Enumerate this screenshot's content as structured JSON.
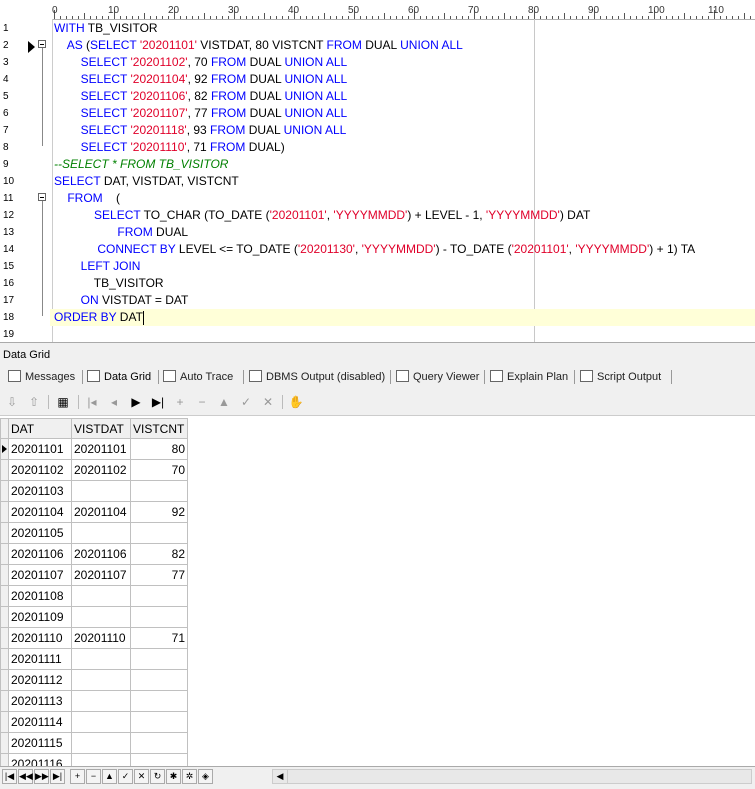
{
  "editor": {
    "ruler_labels": [
      "0",
      "10",
      "20",
      "30",
      "40",
      "50",
      "60",
      "70",
      "80",
      "90",
      "100",
      "110"
    ],
    "line_numbers": [
      "1",
      "2",
      "3",
      "4",
      "5",
      "6",
      "7",
      "8",
      "9",
      "10",
      "11",
      "12",
      "13",
      "14",
      "15",
      "16",
      "17",
      "18",
      "19"
    ],
    "lines": [
      [
        [
          "k",
          "WITH "
        ],
        [
          "n",
          "TB_VISITOR"
        ]
      ],
      [
        [
          "n",
          "    "
        ],
        [
          "k",
          "AS "
        ],
        [
          "n",
          "("
        ],
        [
          "k",
          "SELECT "
        ],
        [
          "s",
          "'20201101'"
        ],
        [
          "n",
          " VISTDAT, 80 VISTCNT "
        ],
        [
          "k",
          "FROM "
        ],
        [
          "n",
          "DUAL "
        ],
        [
          "k",
          "UNION ALL"
        ]
      ],
      [
        [
          "n",
          "        "
        ],
        [
          "k",
          "SELECT "
        ],
        [
          "s",
          "'20201102'"
        ],
        [
          "n",
          ", 70 "
        ],
        [
          "k",
          "FROM "
        ],
        [
          "n",
          "DUAL "
        ],
        [
          "k",
          "UNION ALL"
        ]
      ],
      [
        [
          "n",
          "        "
        ],
        [
          "k",
          "SELECT "
        ],
        [
          "s",
          "'20201104'"
        ],
        [
          "n",
          ", 92 "
        ],
        [
          "k",
          "FROM "
        ],
        [
          "n",
          "DUAL "
        ],
        [
          "k",
          "UNION ALL"
        ]
      ],
      [
        [
          "n",
          "        "
        ],
        [
          "k",
          "SELECT "
        ],
        [
          "s",
          "'20201106'"
        ],
        [
          "n",
          ", 82 "
        ],
        [
          "k",
          "FROM "
        ],
        [
          "n",
          "DUAL "
        ],
        [
          "k",
          "UNION ALL"
        ]
      ],
      [
        [
          "n",
          "        "
        ],
        [
          "k",
          "SELECT "
        ],
        [
          "s",
          "'20201107'"
        ],
        [
          "n",
          ", 77 "
        ],
        [
          "k",
          "FROM "
        ],
        [
          "n",
          "DUAL "
        ],
        [
          "k",
          "UNION ALL"
        ]
      ],
      [
        [
          "n",
          "        "
        ],
        [
          "k",
          "SELECT "
        ],
        [
          "s",
          "'20201118'"
        ],
        [
          "n",
          ", 93 "
        ],
        [
          "k",
          "FROM "
        ],
        [
          "n",
          "DUAL "
        ],
        [
          "k",
          "UNION ALL"
        ]
      ],
      [
        [
          "n",
          "        "
        ],
        [
          "k",
          "SELECT "
        ],
        [
          "s",
          "'20201110'"
        ],
        [
          "n",
          ", 71 "
        ],
        [
          "k",
          "FROM "
        ],
        [
          "n",
          "DUAL)"
        ]
      ],
      [
        [
          "c",
          "--SELECT * FROM TB_VISITOR"
        ]
      ],
      [
        [
          "k",
          "SELECT "
        ],
        [
          "n",
          "DAT, VISTDAT, VISTCNT"
        ]
      ],
      [
        [
          "n",
          "    "
        ],
        [
          "k",
          "FROM"
        ],
        [
          "n",
          "    ("
        ]
      ],
      [
        [
          "n",
          "            "
        ],
        [
          "k",
          "SELECT "
        ],
        [
          "n",
          "TO_CHAR (TO_DATE ("
        ],
        [
          "s",
          "'20201101'"
        ],
        [
          "n",
          ", "
        ],
        [
          "s",
          "'YYYYMMDD'"
        ],
        [
          "n",
          ") + LEVEL - 1, "
        ],
        [
          "s",
          "'YYYYMMDD'"
        ],
        [
          "n",
          ") DAT"
        ]
      ],
      [
        [
          "n",
          "                   "
        ],
        [
          "k",
          "FROM "
        ],
        [
          "n",
          "DUAL"
        ]
      ],
      [
        [
          "n",
          "             "
        ],
        [
          "k",
          "CONNECT BY "
        ],
        [
          "n",
          "LEVEL <= TO_DATE ("
        ],
        [
          "s",
          "'20201130'"
        ],
        [
          "n",
          ", "
        ],
        [
          "s",
          "'YYYYMMDD'"
        ],
        [
          "n",
          ") - TO_DATE ("
        ],
        [
          "s",
          "'20201101'"
        ],
        [
          "n",
          ", "
        ],
        [
          "s",
          "'YYYYMMDD'"
        ],
        [
          "n",
          ") + 1) TA"
        ]
      ],
      [
        [
          "n",
          "        "
        ],
        [
          "k",
          "LEFT JOIN"
        ]
      ],
      [
        [
          "n",
          "            TB_VISITOR"
        ]
      ],
      [
        [
          "n",
          "        "
        ],
        [
          "k",
          "ON "
        ],
        [
          "n",
          "VISTDAT = DAT"
        ]
      ],
      [
        [
          "k",
          "ORDER BY "
        ],
        [
          "n",
          "DAT"
        ]
      ],
      []
    ]
  },
  "panel": {
    "title": "Data Grid",
    "tabs": [
      "Messages",
      "Data Grid",
      "Auto Trace",
      "DBMS Output (disabled)",
      "Query Viewer",
      "Explain Plan",
      "Script Output"
    ]
  },
  "grid": {
    "columns": [
      "DAT",
      "VISTDAT",
      "VISTCNT"
    ],
    "rows": [
      [
        "20201101",
        "20201101",
        "80"
      ],
      [
        "20201102",
        "20201102",
        "70"
      ],
      [
        "20201103",
        "",
        ""
      ],
      [
        "20201104",
        "20201104",
        "92"
      ],
      [
        "20201105",
        "",
        ""
      ],
      [
        "20201106",
        "20201106",
        "82"
      ],
      [
        "20201107",
        "20201107",
        "77"
      ],
      [
        "20201108",
        "",
        ""
      ],
      [
        "20201109",
        "",
        ""
      ],
      [
        "20201110",
        "20201110",
        "71"
      ],
      [
        "20201111",
        "",
        ""
      ],
      [
        "20201112",
        "",
        ""
      ],
      [
        "20201113",
        "",
        ""
      ],
      [
        "20201114",
        "",
        ""
      ],
      [
        "20201115",
        "",
        ""
      ],
      [
        "20201116",
        "",
        ""
      ]
    ]
  }
}
